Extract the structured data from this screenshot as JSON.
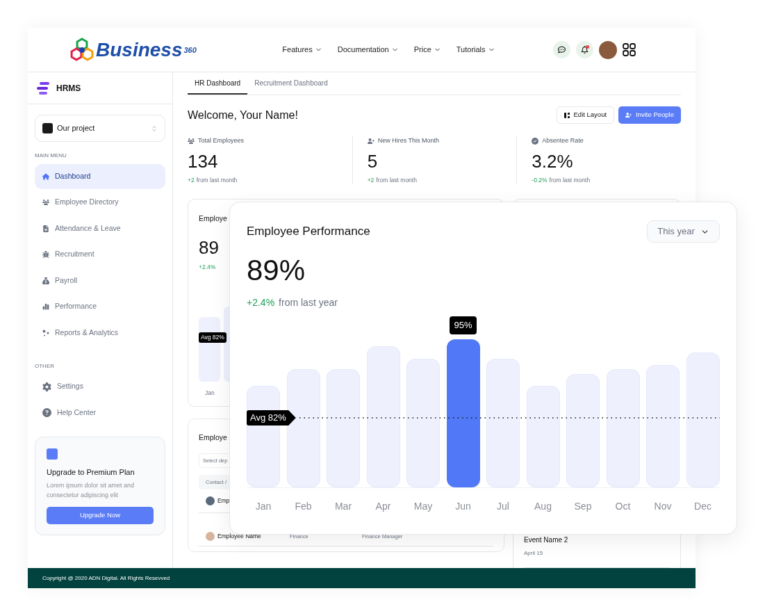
{
  "header": {
    "logo": {
      "text": "Business",
      "superscript": "360"
    },
    "nav": [
      {
        "label": "Features"
      },
      {
        "label": "Documentation"
      },
      {
        "label": "Price"
      },
      {
        "label": "Tutorials"
      }
    ],
    "notification_unread": true
  },
  "sidebar": {
    "app_name": "HRMS",
    "project": "Our project",
    "sections": [
      {
        "title": "MAIN MENU",
        "items": [
          {
            "label": "Dashboard",
            "selected": true
          },
          {
            "label": "Employee Directory",
            "selected": false
          },
          {
            "label": "Attendance & Leave",
            "selected": false
          },
          {
            "label": "Recruitment",
            "selected": false
          },
          {
            "label": "Payroll",
            "selected": false
          },
          {
            "label": "Performance",
            "selected": false
          },
          {
            "label": "Reports & Analytics",
            "selected": false
          }
        ]
      },
      {
        "title": "OTHER",
        "items": [
          {
            "label": "Settings",
            "selected": false
          },
          {
            "label": "Help Center",
            "selected": false
          }
        ]
      }
    ],
    "upgrade": {
      "title": "Upgrade to Premium Plan",
      "text": "Lorem ipsum dolor sit amet and consectetur adipiscing elit",
      "button": "Upgrade Now"
    }
  },
  "tabs": [
    {
      "label": "HR Dashboard",
      "selected": true
    },
    {
      "label": "Recruitment Dashboard",
      "selected": false
    }
  ],
  "welcome": "Welcome, Your Name!",
  "actions": [
    {
      "label": "Edit Layout",
      "kind": "secondary"
    },
    {
      "label": "Invite People",
      "kind": "primary"
    }
  ],
  "stats": [
    {
      "label": "Total Employees",
      "value": "134",
      "change": "+2",
      "note": "from last month"
    },
    {
      "label": "New Hires This Month",
      "value": "5",
      "change": "+2",
      "note": "from last month"
    },
    {
      "label": "Absentee Rate",
      "value": "3.2%",
      "change": "-0.2%",
      "note": "from last month"
    }
  ],
  "performance_card": {
    "title": "Employe",
    "value": "89",
    "change": "+2.4%",
    "average_label": "Avg 82%",
    "month": "Jan"
  },
  "employees_card": {
    "title": "Employe",
    "filter_placeholder": "Select dep",
    "column_header": "Contact /",
    "rows": [
      {
        "name": "Emp"
      },
      {
        "name": "Employee Name",
        "department": "Finance",
        "role": "Finance Manager"
      }
    ]
  },
  "events": [
    {
      "name": "Event Name 2",
      "date": "April 15"
    }
  ],
  "performance_popup": {
    "title": "Employee Performance",
    "period": "This year",
    "value": "89%",
    "change": "+2.4%",
    "note": "from last year",
    "highlight_label": "95%",
    "average_label": "Avg 82%",
    "months": [
      {
        "label": "Jan",
        "selected": false
      },
      {
        "label": "Feb",
        "selected": false
      },
      {
        "label": "Mar",
        "selected": false
      },
      {
        "label": "Apr",
        "selected": false
      },
      {
        "label": "May",
        "selected": false
      },
      {
        "label": "Jun",
        "selected": true
      },
      {
        "label": "Jul",
        "selected": false
      },
      {
        "label": "Aug",
        "selected": false
      },
      {
        "label": "Sep",
        "selected": false
      },
      {
        "label": "Oct",
        "selected": false
      },
      {
        "label": "Nov",
        "selected": false
      },
      {
        "label": "Dec",
        "selected": false
      }
    ]
  },
  "footer": "Copyright @ 2020 ADN Digital. All Rights Resevved"
}
